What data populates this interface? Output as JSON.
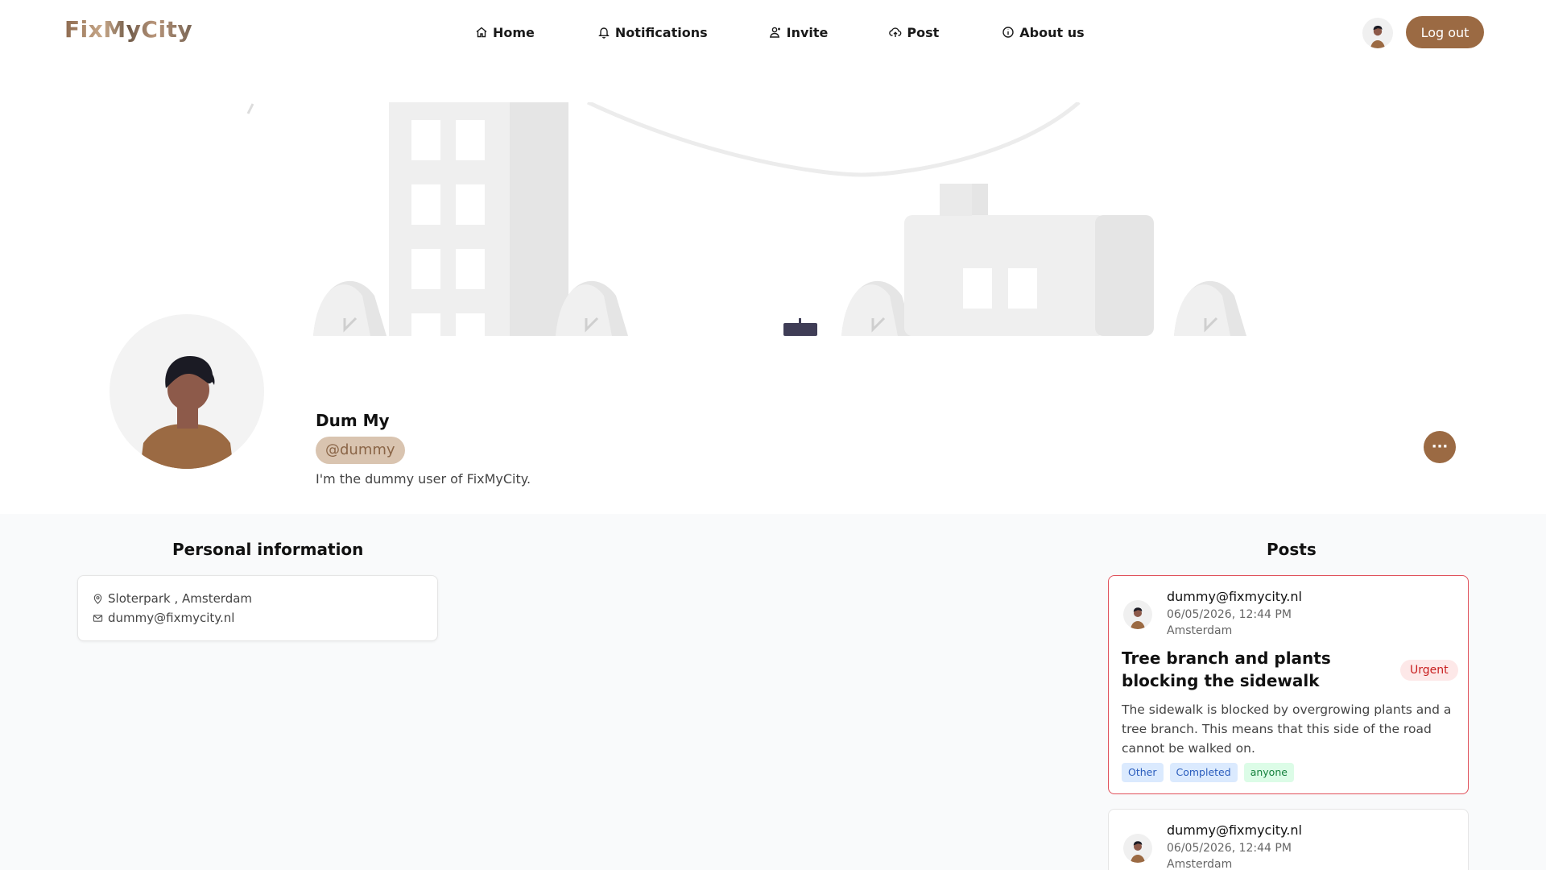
{
  "header": {
    "logo": "FixMyCity",
    "nav": [
      {
        "label": "Home",
        "icon": "home-icon"
      },
      {
        "label": "Notifications",
        "icon": "bell-icon"
      },
      {
        "label": "Invite",
        "icon": "user-plus-icon"
      },
      {
        "label": "Post",
        "icon": "cloud-upload-icon"
      },
      {
        "label": "About us",
        "icon": "info-icon"
      }
    ],
    "logout_label": "Log out"
  },
  "profile": {
    "name": "Dum My",
    "handle": "@dummy",
    "bio": "I'm the dummy user of FixMyCity.",
    "more_label": "···"
  },
  "personal_info": {
    "title": "Personal information",
    "location": "Sloterpark , Amsterdam",
    "email": "dummy@fixmycity.nl"
  },
  "posts": {
    "title": "Posts",
    "items": [
      {
        "author": "dummy@fixmycity.nl",
        "date": "06/05/2026, 12:44 PM",
        "location": "Amsterdam",
        "title": "Tree branch and plants blocking the sidewalk",
        "badge": "Urgent",
        "description": "The sidewalk is blocked by overgrowing plants and a tree branch. This means that this side of the road cannot be walked on.",
        "tags": [
          "Other",
          "Completed",
          "anyone"
        ]
      },
      {
        "author": "dummy@fixmycity.nl",
        "date": "06/05/2026, 12:44 PM",
        "location": "Amsterdam"
      }
    ]
  },
  "colors": {
    "brand": "#9b6a43",
    "urgent": "#e0505a",
    "page_bg": "#f9fafb"
  }
}
